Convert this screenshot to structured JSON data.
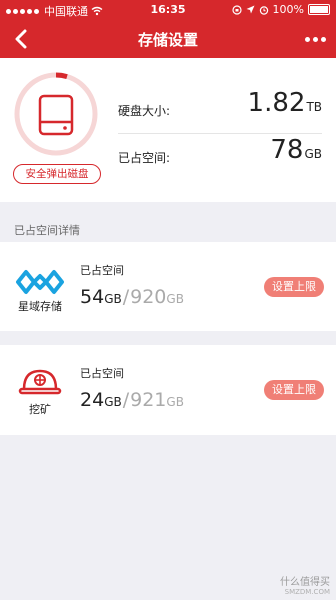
{
  "status_bar": {
    "carrier": "中国联通",
    "time": "16:35",
    "battery": "100%"
  },
  "nav": {
    "title": "存储设置"
  },
  "summary": {
    "eject_label": "安全弹出磁盘",
    "disk_size_label": "硬盘大小:",
    "disk_size_value": "1.82",
    "disk_size_unit": "TB",
    "used_label": "已占空间:",
    "used_value": "78",
    "used_unit": "GB"
  },
  "section_title": "已占空间详情",
  "cards": [
    {
      "name": "星域存储",
      "used_label": "已占空间",
      "used": "54",
      "used_unit": "GB",
      "total": "920",
      "total_unit": "GB",
      "button": "设置上限"
    },
    {
      "name": "挖矿",
      "used_label": "已占空间",
      "used": "24",
      "used_unit": "GB",
      "total": "921",
      "total_unit": "GB",
      "button": "设置上限"
    }
  ],
  "watermark": {
    "text": "什么值得买",
    "sub": "SMZDM.COM"
  },
  "colors": {
    "brand_red": "#d6282c",
    "ring_track": "#f6d6d6",
    "limit_button": "#f07f76",
    "icon_blue": "#1aa3e0"
  }
}
